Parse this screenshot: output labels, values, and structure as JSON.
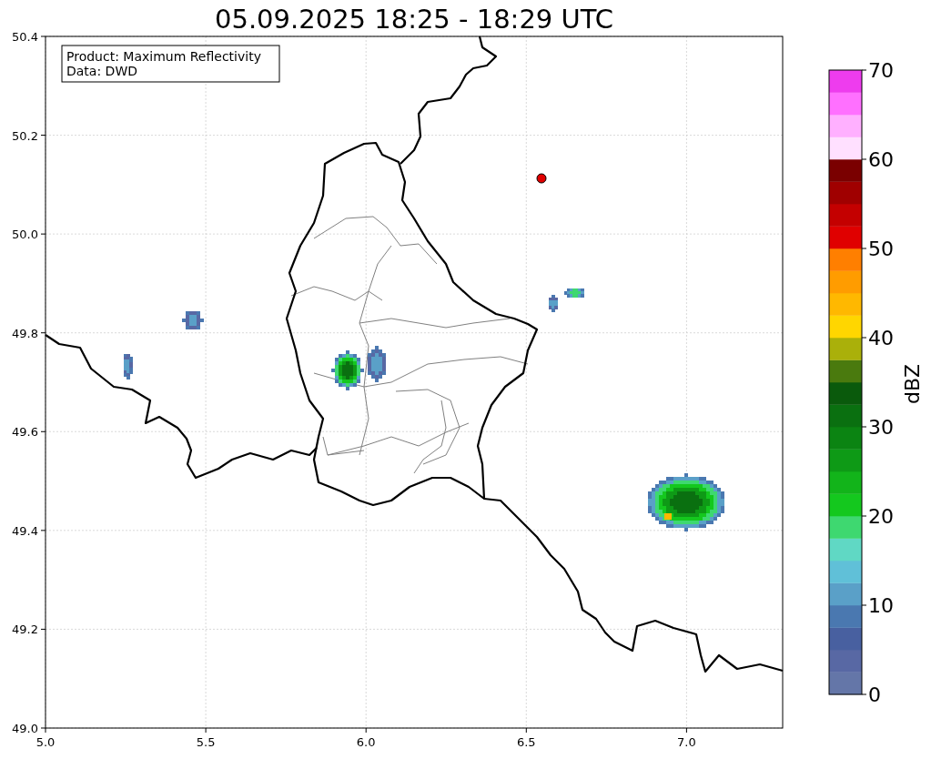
{
  "title": "05.09.2025 18:25 - 18:29 UTC",
  "map": {
    "x_ticks": [
      "5.0",
      "5.5",
      "6.0",
      "6.5",
      "7.0"
    ],
    "y_ticks": [
      "50.4",
      "50.2",
      "50.0",
      "49.8",
      "49.6",
      "49.4",
      "49.2",
      "49.0"
    ],
    "info_box": [
      "Product: Maximum Reflectivity",
      "Data: DWD"
    ]
  },
  "colorbar": {
    "label": "dBZ",
    "ticks": [
      "70",
      "60",
      "50",
      "40",
      "30",
      "20",
      "10",
      "0"
    ],
    "bands": [
      {
        "color": "#6476a8"
      },
      {
        "color": "#5868a4"
      },
      {
        "color": "#4860a0"
      },
      {
        "color": "#4a78b0"
      },
      {
        "color": "#5aa0c8"
      },
      {
        "color": "#60c0d8"
      },
      {
        "color": "#60d8c4"
      },
      {
        "color": "#3ed870"
      },
      {
        "color": "#14c81e"
      },
      {
        "color": "#12b41a"
      },
      {
        "color": "#0e9a16"
      },
      {
        "color": "#0b8412"
      },
      {
        "color": "#0a7010"
      },
      {
        "color": "#0a5a0c"
      },
      {
        "color": "#4a7a0e"
      },
      {
        "color": "#aab00a"
      },
      {
        "color": "#ffd600"
      },
      {
        "color": "#ffb800"
      },
      {
        "color": "#ff9c00"
      },
      {
        "color": "#ff7f00"
      },
      {
        "color": "#e00000"
      },
      {
        "color": "#c40000"
      },
      {
        "color": "#a00000"
      },
      {
        "color": "#7a0000"
      },
      {
        "color": "#ffe0ff"
      },
      {
        "color": "#ffb0ff"
      },
      {
        "color": "#ff70ff"
      },
      {
        "color": "#ee3cee"
      }
    ]
  }
}
